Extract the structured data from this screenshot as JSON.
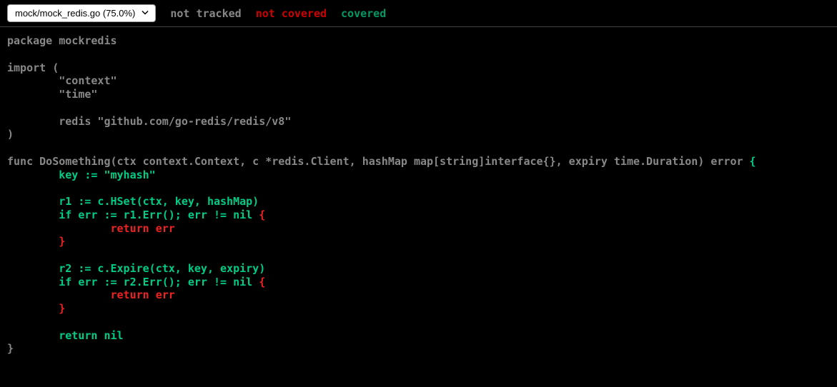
{
  "topbar": {
    "file_select_label": "mock/mock_redis.go (75.0%)",
    "legend_not_tracked": "not tracked",
    "legend_not_covered": "not covered",
    "legend_covered": "covered"
  },
  "code": {
    "l1": "package mockredis",
    "l2": "",
    "l3": "import (",
    "l4": "        \"context\"",
    "l5": "        \"time\"",
    "l6": "",
    "l7": "        redis \"github.com/go-redis/redis/v8\"",
    "l8": ")",
    "l9": "",
    "l10a": "func DoSomething(ctx context.Context, c *redis.Client, hashMap map[string]interface{}, expiry time.Duration) error ",
    "l10b": "{",
    "l11": "        key := \"myhash\"",
    "l12": "",
    "l13": "        r1 := c.HSet(ctx, key, hashMap)",
    "l14": "        if err := r1.Err(); err != nil ",
    "l14b": "{",
    "l15": "                return err",
    "l16": "        }",
    "l17": "",
    "l18": "        r2 := c.Expire(ctx, key, expiry)",
    "l19": "        if err := r2.Err(); err != nil ",
    "l19b": "{",
    "l20": "                return err",
    "l21": "        }",
    "l22": "",
    "l23": "        return nil",
    "l24": "}"
  }
}
